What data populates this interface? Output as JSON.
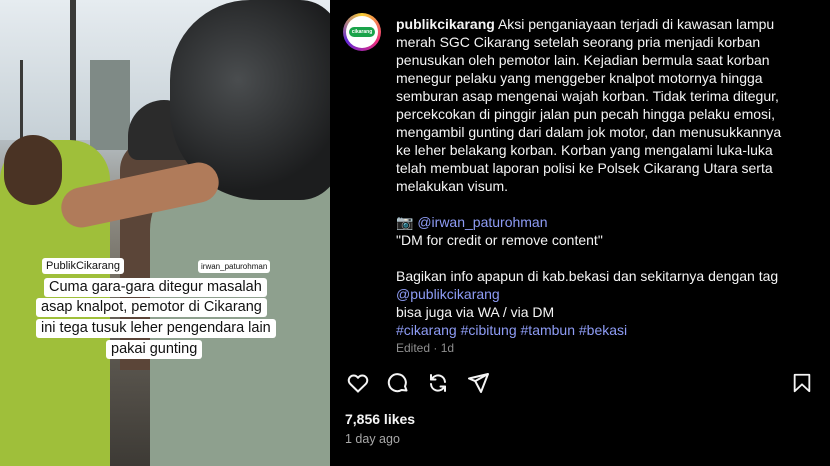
{
  "media": {
    "caption_tag_left": "PublikCikarang",
    "caption_tag_right": "irwan_paturohman",
    "caption_lines": [
      "Cuma gara-gara ditegur masalah",
      "asap knalpot, pemotor di Cikarang",
      "ini tega tusuk leher pengendara lain",
      "pakai gunting"
    ]
  },
  "post": {
    "avatar_logo": "cikarang",
    "username": "publikcikarang",
    "caption": "Aksi penganiayaan terjadi di kawasan lampu merah SGC Cikarang setelah seorang pria menjadi korban penusukan oleh pemotor lain. Kejadian bermula saat korban menegur pelaku yang menggeber knalpot motornya hingga semburan asap mengenai wajah korban. Tidak terima ditegur, percekcokan di pinggir jalan pun pecah hingga pelaku emosi, mengambil gunting dari dalam jok motor, dan menusukkannya ke leher belakang korban. Korban yang mengalami luka-luka telah membuat laporan polisi ke Polsek Cikarang Utara serta melakukan visum.",
    "credit_emoji": "📷",
    "credit_handle": "@irwan_paturohman",
    "credit_note": "\"DM for credit or remove content\"",
    "info_text": "Bagikan info apapun di kab.bekasi dan sekitarnya dengan tag",
    "info_handle": "@publikcikarang",
    "info_contact": "bisa juga via WA / via DM",
    "hashtags": "#cikarang #cibitung #tambun #bekasi",
    "edited": "Edited · 1d",
    "likes": "7,856 likes",
    "time_ago": "1 day ago"
  },
  "icons": {
    "like": "heart-icon",
    "comment": "comment-icon",
    "share": "repost-icon",
    "send": "send-icon",
    "save": "bookmark-icon"
  }
}
